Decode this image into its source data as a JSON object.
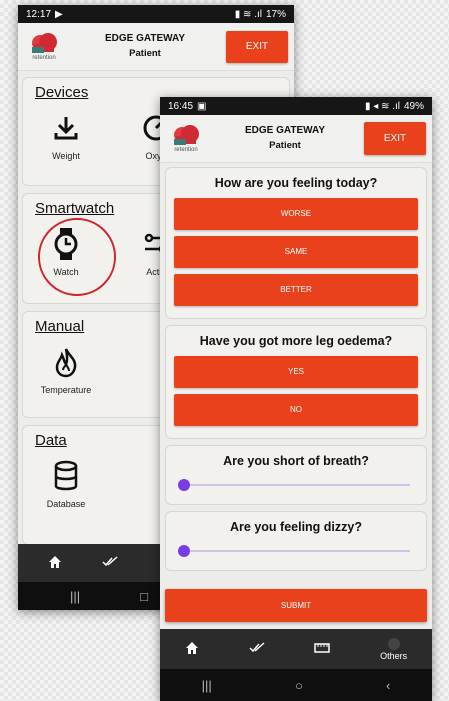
{
  "phone1": {
    "status": {
      "time": "12:17",
      "battery": "17%"
    },
    "header": {
      "logo_text": "retention",
      "title": "EDGE GATEWAY",
      "subtitle": "Patient",
      "exit_label": "EXIT"
    },
    "sections": {
      "devices": {
        "title": "Devices",
        "items": [
          "Weight",
          "Oxyg"
        ]
      },
      "smartwatch": {
        "title": "Smartwatch",
        "items": [
          "Watch",
          "Activ"
        ]
      },
      "manual": {
        "title": "Manual",
        "items": [
          "Temperature"
        ]
      },
      "data": {
        "title": "Data",
        "items": [
          "Database"
        ]
      }
    },
    "nav": {
      "items": [
        "home-icon",
        "check-icon"
      ]
    },
    "system_nav": [
      "recents",
      "home"
    ]
  },
  "phone2": {
    "status": {
      "time": "16:45",
      "battery": "49%"
    },
    "header": {
      "logo_text": "retention",
      "title": "EDGE GATEWAY",
      "subtitle": "Patient",
      "exit_label": "EXIT"
    },
    "questions": {
      "feeling": {
        "text": "How are you feeling today?",
        "options": [
          "WORSE",
          "SAME",
          "BETTER"
        ]
      },
      "oedema": {
        "text": "Have you got more leg oedema?",
        "options": [
          "YES",
          "NO"
        ]
      },
      "breath": {
        "text": "Are you short of breath?",
        "slider_value": 0
      },
      "dizzy": {
        "text": "Are you feeling dizzy?",
        "slider_value": 0
      }
    },
    "submit_label": "SUBMIT",
    "nav": {
      "items": [
        "home-icon",
        "check-icon",
        "ruler-icon"
      ],
      "others_label": "Others"
    },
    "system_nav": [
      "recents",
      "home",
      "back"
    ]
  },
  "colors": {
    "accent": "#e8411b",
    "highlight_circle": "#d0262b",
    "slider": "#7a3ce0",
    "nav_bg": "#2b2b2b"
  }
}
